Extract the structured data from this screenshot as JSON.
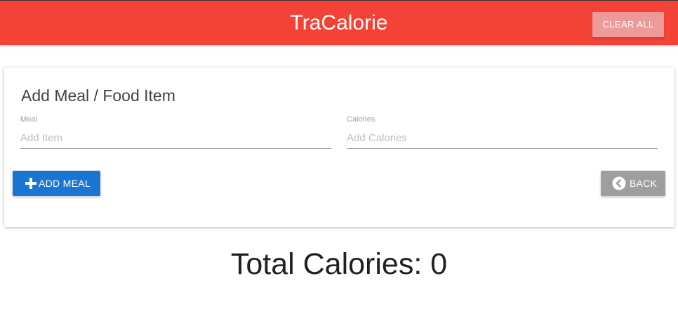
{
  "navbar": {
    "brand": "TraCalorie",
    "clear_all_label": "CLEAR ALL"
  },
  "form": {
    "title": "Add Meal / Food Item",
    "meal": {
      "label": "Meal",
      "placeholder": "Add Item",
      "value": ""
    },
    "calories": {
      "label": "Calories",
      "placeholder": "Add Calories",
      "value": ""
    },
    "add_meal_label": "ADD MEAL",
    "back_label": "BACK"
  },
  "total": {
    "text": "Total Calories: 0"
  },
  "colors": {
    "navbar": "#f44336",
    "clear_button": "#ef9a9a",
    "add_button": "#1976d2",
    "back_button": "#9e9e9e"
  },
  "icons": {
    "add": "plus-icon",
    "back": "chevron-circle-left-icon"
  }
}
